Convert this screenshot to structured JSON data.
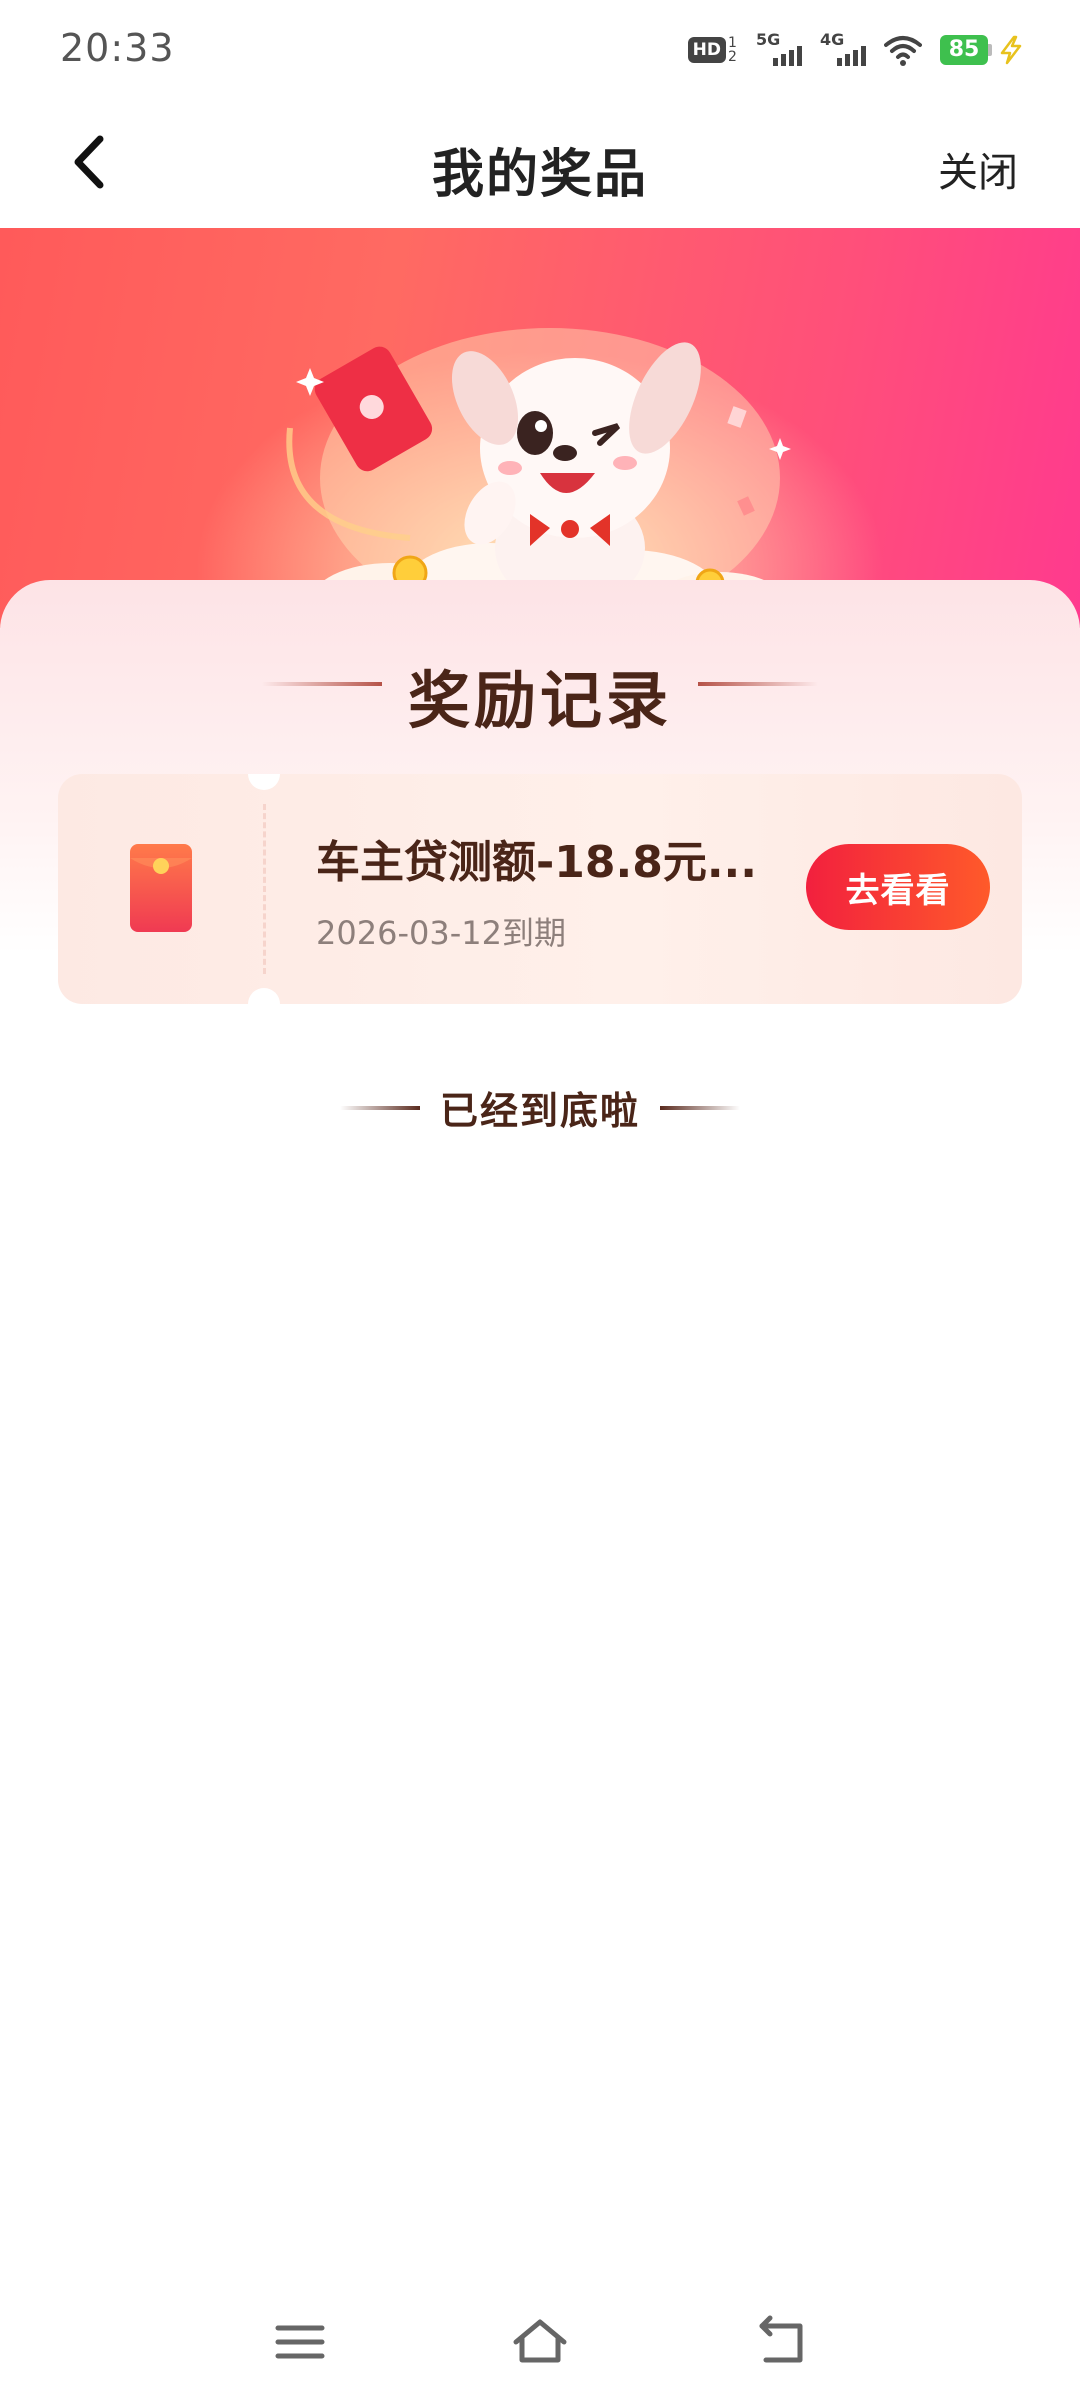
{
  "status_bar": {
    "time": "20:33",
    "hd_label": "HD",
    "hd_sub": "1 2",
    "sim1_network": "5G",
    "sim2_network": "4G",
    "battery_level": "85",
    "icons": [
      "hd-voice-icon",
      "signal-5g-icon",
      "signal-4g-icon",
      "wifi-icon",
      "battery-icon",
      "charging-icon"
    ]
  },
  "header": {
    "title": "我的奖品",
    "close_label": "关闭",
    "back_icon": "chevron-left-icon"
  },
  "records": {
    "section_title": "奖励记录",
    "items": [
      {
        "name": "车主贷测额-18.8元...",
        "expire": "2026-03-12到期",
        "button_label": "去看看",
        "icon": "red-packet-icon"
      }
    ],
    "end_note": "已经到底啦"
  },
  "colors": {
    "banner_start": "#ff5a5a",
    "banner_end": "#ff3a8e",
    "button_start": "#f2203e",
    "button_end": "#ff5a2a",
    "title_text": "#4a2518"
  },
  "nav_bar": {
    "icons": [
      "menu-icon",
      "home-icon",
      "back-icon"
    ]
  }
}
